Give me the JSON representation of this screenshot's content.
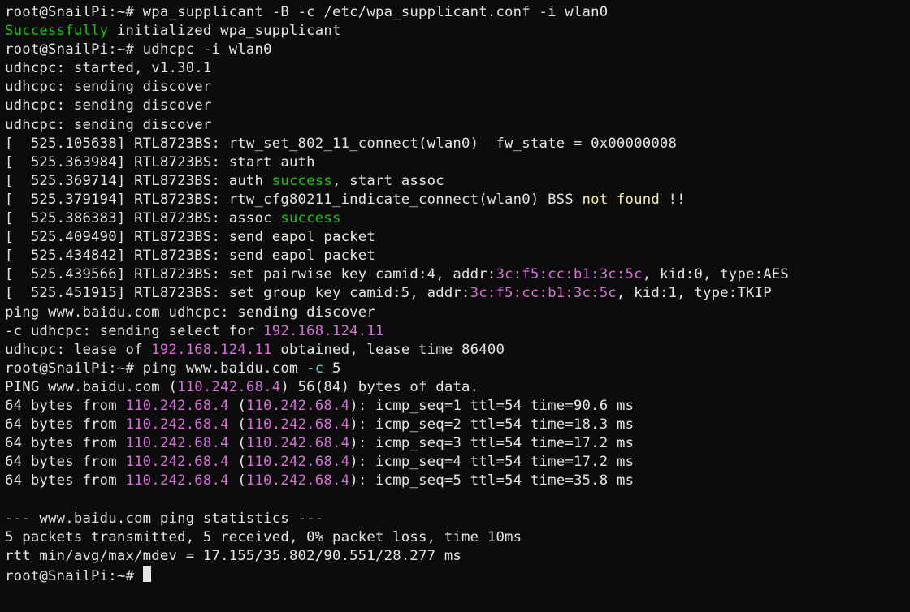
{
  "prompt1": "root@SnailPi:~# ",
  "cmd1": "wpa_supplicant -B -c /etc/wpa_supplicant.conf -i wlan0",
  "ok": "Successfully",
  "ok_rest": " initialized wpa_supplicant",
  "prompt2": "root@SnailPi:~# ",
  "cmd2": "udhcpc -i wlan0",
  "u_start": "udhcpc: started, v1.30.1",
  "u_disc1": "udhcpc: sending discover",
  "u_disc2": "udhcpc: sending discover",
  "u_disc3": "udhcpc: sending discover",
  "k1": "[  525.105638] RTL8723BS: rtw_set_802_11_connect(wlan0)  fw_state = 0x00000008",
  "k2": "[  525.363984] RTL8723BS: start auth",
  "k3_pre": "[  525.369714] RTL8723BS: auth ",
  "k3_suc": "success",
  "k3_post": ", start assoc",
  "k4_pre": "[  525.379194] RTL8723BS: rtw_cfg80211_indicate_connect(wlan0) BSS ",
  "k4_nf": "not found",
  "k4_post": " !!",
  "k5_pre": "[  525.386383] RTL8723BS: assoc ",
  "k5_suc": "success",
  "k6": "[  525.409490] RTL8723BS: send eapol packet",
  "k7": "[  525.434842] RTL8723BS: send eapol packet",
  "k8_pre": "[  525.439566] RTL8723BS: set pairwise key camid:4, addr:",
  "k8_addr": "3c:f5:cc:b1:3c:5c",
  "k8_post": ", kid:0, type:AES",
  "k9_pre": "[  525.451915] RTL8723BS: set group key camid:5, addr:",
  "k9_addr": "3c:f5:cc:b1:3c:5c",
  "k9_post": ", kid:1, type:TKIP",
  "mix1": "ping www.baidu.com udhcpc: sending discover",
  "sel_pre": "-c udhcpc: sending select for ",
  "sel_ip": "192.168.124.11",
  "lease_pre": "udhcpc: lease of ",
  "lease_ip": "192.168.124.11",
  "lease_post": " obtained, lease time 86400",
  "prompt3": "root@SnailPi:~# ",
  "cmd3_a": "ping www.baidu.com ",
  "cmd3_b": "-c",
  "cmd3_c": " 5",
  "ping_hdr_a": "PING www.baidu.com (",
  "ping_hdr_ip": "110.242.68.4",
  "ping_hdr_b": ") 56(84) bytes of data.",
  "pre64": "64 bytes from ",
  "ip_out": "110.242.68.4",
  "sp_op": " (",
  "ip_in": "110.242.68.4",
  "cl_col": "): ",
  "r1": "icmp_seq=1 ttl=54 time=90.6 ms",
  "r2": "icmp_seq=2 ttl=54 time=18.3 ms",
  "r3": "icmp_seq=3 ttl=54 time=17.2 ms",
  "r4": "icmp_seq=4 ttl=54 time=17.2 ms",
  "r5": "icmp_seq=5 ttl=54 time=35.8 ms",
  "stats_hdr": "--- www.baidu.com ping statistics ---",
  "stats1": "5 packets transmitted, 5 received, 0% packet loss, time 10ms",
  "stats2": "rtt min/avg/max/mdev = 17.155/35.802/90.551/28.277 ms",
  "prompt4": "root@SnailPi:~# "
}
